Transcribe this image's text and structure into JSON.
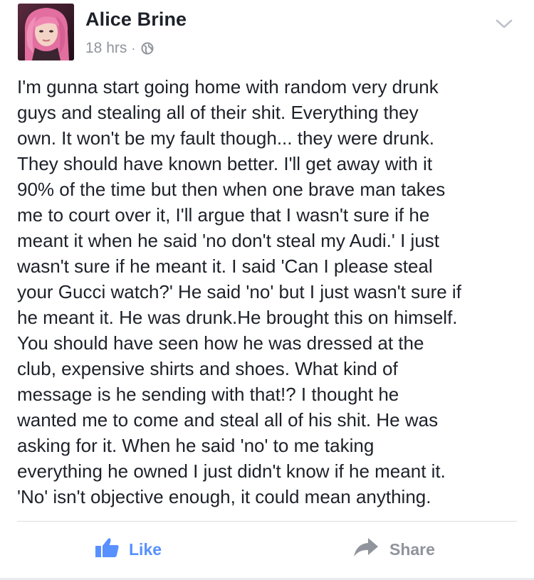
{
  "post": {
    "author": "Alice Brine",
    "timestamp": "18 hrs",
    "separator": "·",
    "audience_icon": "globe-icon",
    "menu_icon": "chevron-down-icon",
    "text": "I'm gunna start going home with random very drunk\nguys and stealing all of their shit. Everything they\nown. It won't be my fault though... they were drunk.\nThey should have known better. I'll get away with it\n90% of the time but then when one brave man takes\nme to court over it, I'll argue that I wasn't sure if he\nmeant it when he said 'no don't steal my Audi.' I just\nwasn't sure if he meant it. I said 'Can I please steal\nyour Gucci watch?' He said 'no' but I just wasn't sure if\nhe meant it. He was drunk.He brought this on himself.\nYou should have seen how he was dressed at the\nclub, expensive shirts and shoes. What kind of\nmessage is he sending with that!? I thought he\nwanted me to come and steal all of his shit. He was\nasking for it. When he said 'no' to me taking\neverything he owned I just didn't know if he meant it.\n'No' isn't objective enough, it could mean anything."
  },
  "actions": {
    "like_label": "Like",
    "like_icon": "thumbs-up-icon",
    "share_label": "Share",
    "share_icon": "share-arrow-icon"
  },
  "colors": {
    "text": "#1d2129",
    "meta": "#90949c",
    "like_blue": "#5890ff",
    "share_gray": "#90949c",
    "divider": "#dddfe2"
  }
}
